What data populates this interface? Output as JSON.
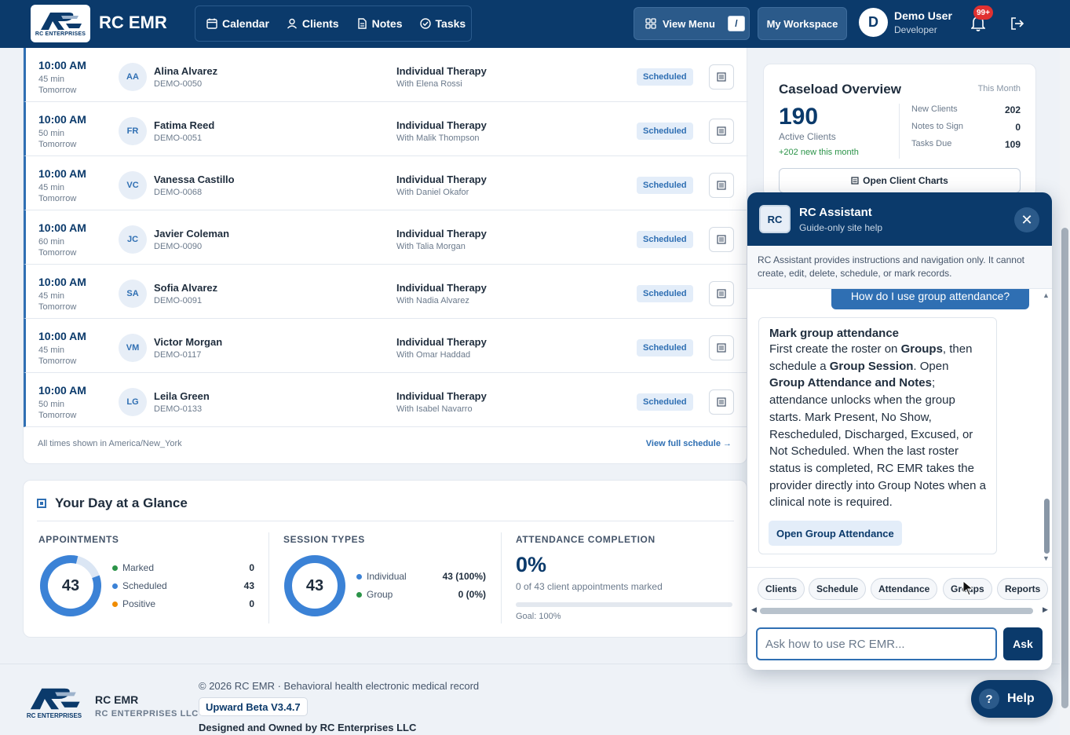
{
  "header": {
    "logo_text": "RC ENTERPRISES",
    "brand": "RC EMR",
    "nav": [
      {
        "label": "Calendar",
        "icon": "calendar-icon"
      },
      {
        "label": "Clients",
        "icon": "user-icon"
      },
      {
        "label": "Notes",
        "icon": "document-icon"
      },
      {
        "label": "Tasks",
        "icon": "check-circle-icon"
      }
    ],
    "view_menu": "View Menu",
    "view_menu_shortcut": "/",
    "workspace": "My Workspace",
    "user": {
      "initial": "D",
      "name": "Demo User",
      "role": "Developer"
    },
    "notifications_badge": "99+"
  },
  "appointments": [
    {
      "time": "10:00 AM",
      "duration": "45 min",
      "day": "Tomorrow",
      "initials": "AA",
      "name": "Alina Alvarez",
      "id": "DEMO-0050",
      "service": "Individual Therapy",
      "with": "With Elena Rossi",
      "status": "Scheduled"
    },
    {
      "time": "10:00 AM",
      "duration": "50 min",
      "day": "Tomorrow",
      "initials": "FR",
      "name": "Fatima Reed",
      "id": "DEMO-0051",
      "service": "Individual Therapy",
      "with": "With Malik Thompson",
      "status": "Scheduled"
    },
    {
      "time": "10:00 AM",
      "duration": "45 min",
      "day": "Tomorrow",
      "initials": "VC",
      "name": "Vanessa Castillo",
      "id": "DEMO-0068",
      "service": "Individual Therapy",
      "with": "With Daniel Okafor",
      "status": "Scheduled"
    },
    {
      "time": "10:00 AM",
      "duration": "60 min",
      "day": "Tomorrow",
      "initials": "JC",
      "name": "Javier Coleman",
      "id": "DEMO-0090",
      "service": "Individual Therapy",
      "with": "With Talia Morgan",
      "status": "Scheduled"
    },
    {
      "time": "10:00 AM",
      "duration": "45 min",
      "day": "Tomorrow",
      "initials": "SA",
      "name": "Sofia Alvarez",
      "id": "DEMO-0091",
      "service": "Individual Therapy",
      "with": "With Nadia Alvarez",
      "status": "Scheduled"
    },
    {
      "time": "10:00 AM",
      "duration": "45 min",
      "day": "Tomorrow",
      "initials": "VM",
      "name": "Victor Morgan",
      "id": "DEMO-0117",
      "service": "Individual Therapy",
      "with": "With Omar Haddad",
      "status": "Scheduled"
    },
    {
      "time": "10:00 AM",
      "duration": "50 min",
      "day": "Tomorrow",
      "initials": "LG",
      "name": "Leila Green",
      "id": "DEMO-0133",
      "service": "Individual Therapy",
      "with": "With Isabel Navarro",
      "status": "Scheduled"
    }
  ],
  "schedule_footer": {
    "timezone_note": "All times shown in America/New_York",
    "link": "View full schedule →"
  },
  "glance": {
    "title": "Your Day at a Glance",
    "appointments": {
      "heading": "APPOINTMENTS",
      "total": "43",
      "legend": [
        {
          "label": "Marked",
          "value": "0",
          "color": "#2b9348"
        },
        {
          "label": "Scheduled",
          "value": "43",
          "color": "#3b82d6"
        },
        {
          "label": "Positive",
          "value": "0",
          "color": "#f08c00"
        }
      ]
    },
    "session_types": {
      "heading": "SESSION TYPES",
      "total": "43",
      "legend": [
        {
          "label": "Individual",
          "value": "43 (100%)",
          "color": "#3b82d6"
        },
        {
          "label": "Group",
          "value": "0 (0%)",
          "color": "#2b9348"
        }
      ]
    },
    "attendance": {
      "heading": "ATTENDANCE COMPLETION",
      "percent": "0%",
      "fraction": 0,
      "subtitle": "0 of 43 client appointments marked",
      "goal": "Goal: 100%"
    }
  },
  "caseload": {
    "title": "Caseload Overview",
    "period": "This Month",
    "active_count": "190",
    "active_label": "Active Clients",
    "new_this_month": "+202 new this month",
    "stats": [
      {
        "label": "New Clients",
        "value": "202"
      },
      {
        "label": "Notes to Sign",
        "value": "0"
      },
      {
        "label": "Tasks Due",
        "value": "109"
      }
    ],
    "open_charts": "Open Client Charts"
  },
  "assistant": {
    "logo": "RC",
    "title": "RC Assistant",
    "subtitle": "Guide-only site help",
    "disclaimer": "RC Assistant provides instructions and navigation only. It cannot create, edit, delete, schedule, or mark records.",
    "user_question": "How do I use group attendance?",
    "reply_title": "Mark group attendance",
    "reply_parts": [
      {
        "t": "First create the roster on "
      },
      {
        "t": "Groups",
        "b": true
      },
      {
        "t": ", then schedule a "
      },
      {
        "t": "Group Session",
        "b": true
      },
      {
        "t": ". Open "
      },
      {
        "t": "Group Attendance and Notes",
        "b": true
      },
      {
        "t": "; attendance unlocks when the group starts. Mark Present, No Show, Rescheduled, Discharged, Excused, or Not Scheduled. When the last roster status is completed, RC EMR takes the provider directly into Group Notes when a clinical note is required."
      }
    ],
    "reply_link": "Open Group Attendance",
    "chips": [
      "Clients",
      "Schedule",
      "Attendance",
      "Groups",
      "Reports"
    ],
    "input_placeholder": "Ask how to use RC EMR...",
    "input_value": "",
    "ask": "Ask"
  },
  "help": {
    "label": "Help"
  },
  "footer": {
    "brand": "RC EMR",
    "company": "RC ENTERPRISES LLC",
    "logo_text": "RC ENTERPRISES",
    "copyright": "© 2026 RC EMR · Behavioral health electronic medical record",
    "version": "Upward Beta V3.4.7",
    "owned": "Designed and Owned by RC Enterprises LLC"
  }
}
